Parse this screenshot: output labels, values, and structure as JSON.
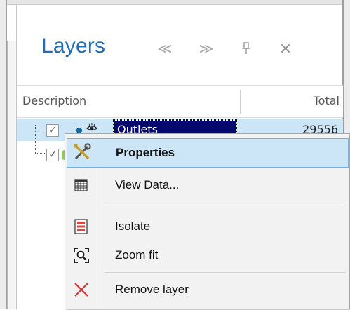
{
  "panel": {
    "title": "Layers",
    "header_buttons": {
      "prev_icon": "double-chevron-left-icon",
      "next_icon": "double-chevron-right-icon",
      "pin_icon": "pin-icon",
      "close_icon": "close-icon",
      "prev_glyph": "≪",
      "next_glyph": "≫",
      "pin_glyph": "⊥",
      "close_glyph": "×"
    }
  },
  "columns": {
    "description": "Description",
    "total": "Total"
  },
  "layers": [
    {
      "name": "Outlets",
      "total": "29556",
      "checked": true,
      "selected": true
    },
    {
      "name": "",
      "total": "",
      "checked": true,
      "selected": false
    }
  ],
  "context_menu": {
    "items": [
      {
        "label": "Properties",
        "icon": "tools-icon",
        "selected": true
      },
      {
        "label": "View Data...",
        "icon": "table-icon",
        "selected": false
      },
      {
        "label": "Isolate",
        "icon": "isolate-icon",
        "selected": false
      },
      {
        "label": "Zoom fit",
        "icon": "zoom-fit-icon",
        "selected": false
      },
      {
        "label": "Remove layer",
        "icon": "remove-icon",
        "selected": false
      }
    ]
  },
  "colors": {
    "title": "#1f6fb8",
    "selection_bg": "#cde6f7",
    "name_highlight": "#06086e",
    "remove_red": "#d9342b"
  }
}
